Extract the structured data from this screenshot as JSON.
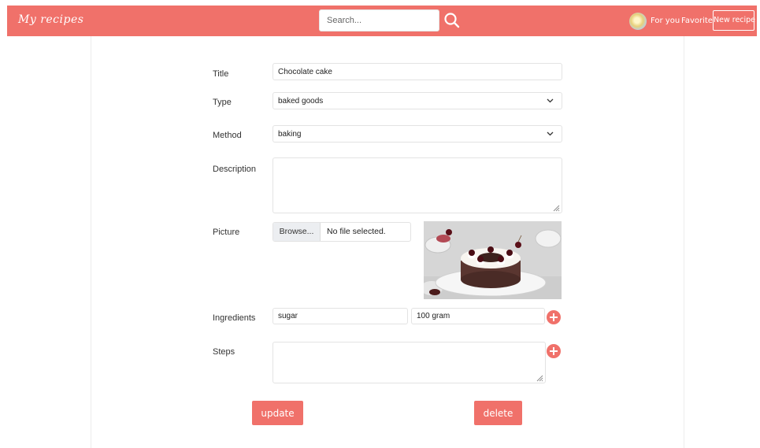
{
  "navbar": {
    "brand": "My recipes",
    "search_placeholder": "Search...",
    "links": {
      "for_you": "For you",
      "favorite": "Favorite",
      "new_recipe": "New recipe"
    }
  },
  "form": {
    "labels": {
      "title": "Title",
      "type": "Type",
      "method": "Method",
      "description": "Description",
      "picture": "Picture",
      "ingredients": "Ingredients",
      "steps": "Steps"
    },
    "title_value": "Chocolate cake",
    "type_value": "baked goods",
    "method_value": "baking",
    "description_value": "",
    "file": {
      "button": "Browse...",
      "status": "No file selected."
    },
    "ingredient": {
      "name": "sugar",
      "amount": "100 gram"
    },
    "steps_value": ""
  },
  "actions": {
    "update": "update",
    "delete": "delete"
  },
  "icons": {
    "search": "search-icon",
    "add": "plus-circle-icon",
    "dropdown": "chevron-down-icon",
    "resize": "resize-handle-icon"
  },
  "colors": {
    "accent": "#f0716a",
    "border": "#e3e3e3"
  }
}
